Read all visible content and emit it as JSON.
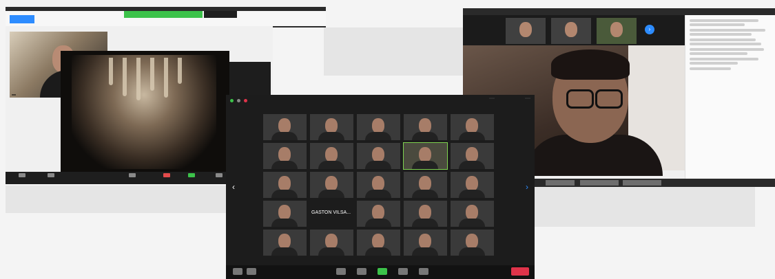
{
  "left_window": {
    "self_name": "",
    "toolbar": [
      "",
      "",
      "",
      "",
      "",
      ""
    ]
  },
  "right_window": {
    "thumbs": [
      "",
      "",
      ""
    ],
    "chat_title": "",
    "chat": [
      {
        "who": "",
        "text": ""
      },
      {
        "who": "",
        "text": ""
      },
      {
        "who": "",
        "text": ""
      },
      {
        "who": "",
        "text": ""
      },
      {
        "who": "",
        "text": ""
      },
      {
        "who": "",
        "text": ""
      }
    ]
  },
  "center_window": {
    "recording_label": "",
    "speaker_view": "",
    "fullscreen": "",
    "end_button": "",
    "speaker_text": "GASTON VILSA..."
  },
  "colors": {
    "zoom_blue": "#2d8cff",
    "active_green": "#3cc24a",
    "end_red": "#e0334a"
  }
}
